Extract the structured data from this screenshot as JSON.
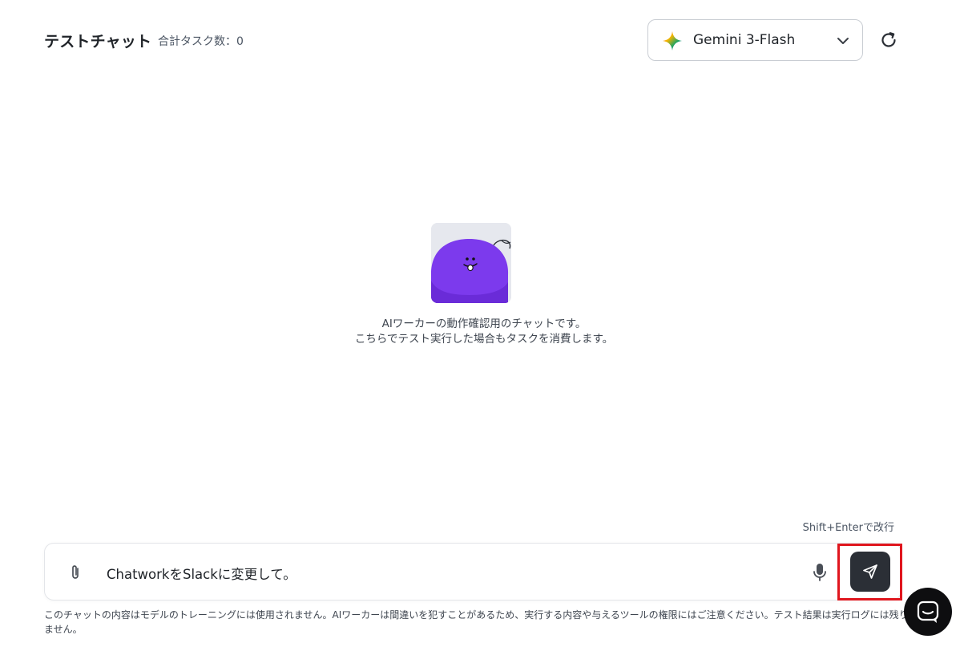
{
  "header": {
    "title": "テストチャット",
    "task_count": "合計タスク数：0",
    "model": {
      "label": "Gemini 3-Flash",
      "icon": "gemini-sparkle-icon"
    },
    "refresh_icon": "refresh-icon"
  },
  "main": {
    "line1": "AIワーカーの動作確認用のチャットです。",
    "line2": "こちらでテスト実行した場合もタスクを消費します。"
  },
  "composer": {
    "hint": "Shift+Enterで改行",
    "value": "ChatworkをSlackに変更して。",
    "attach_icon": "paperclip-icon",
    "mic_icon": "microphone-icon",
    "send_icon": "send-icon"
  },
  "disclaimer": "このチャットの内容はモデルのトレーニングには使用されません。AIワーカーは間違いを犯すことがあるため、実行する内容や与えるツールの権限にはご注意ください。テスト結果は実行ログには残りません。",
  "colors": {
    "send_button": "#2b2f36",
    "highlight_box": "#e0161e",
    "mascot": "#7c3aed",
    "launcher": "#0e0e10"
  }
}
